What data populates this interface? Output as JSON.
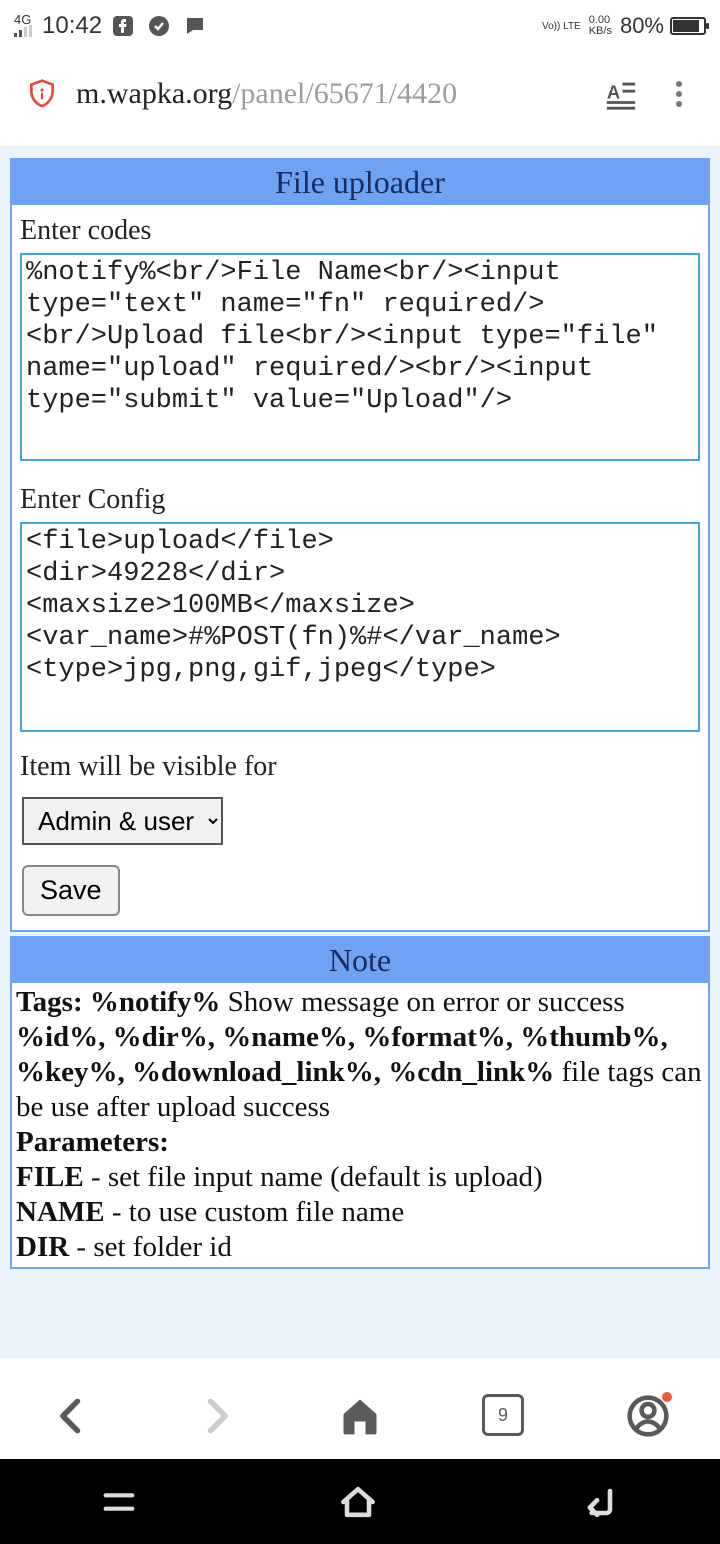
{
  "status": {
    "network_label": "4G",
    "time": "10:42",
    "vol_lte": "Vo)) LTE",
    "speed_top": "0.00",
    "speed_bottom": "KB/s",
    "battery_pct": "80%"
  },
  "address_bar": {
    "host": "m.wapka.org",
    "path": "/panel/65671/4420"
  },
  "uploader": {
    "title": "File uploader",
    "label_codes": "Enter codes",
    "codes_value": "%notify%<br/>File Name<br/><input type=\"text\" name=\"fn\" required/><br/>Upload file<br/><input type=\"file\" name=\"upload\" required/><br/><input type=\"submit\" value=\"Upload\"/>",
    "label_config": "Enter Config",
    "config_value": "<file>upload</file>\n<dir>49228</dir>\n<maxsize>100MB</maxsize>\n<var_name>#%POST(fn)%#</var_name>\n<type>jpg,png,gif,jpeg</type>",
    "label_visibility": "Item will be visible for",
    "visibility_option": "Admin & user",
    "save_label": "Save"
  },
  "note": {
    "title": "Note",
    "tags_label": "Tags: %notify%",
    "tags_desc": " Show message on error or success",
    "filetags_bold": "%id%, %dir%, %name%, %format%, %thumb%, %key%, %download_link%, %cdn_link%",
    "filetags_desc": " file tags can be use after upload success",
    "parameters_label": "Parameters:",
    "p_file_b": "FILE",
    "p_file": " - set file input name (default is upload)",
    "p_name_b": "NAME",
    "p_name": " - to use custom file name",
    "p_dir_b": "DIR",
    "p_dir": " - set folder id"
  },
  "bottom_nav": {
    "tab_count": "9"
  }
}
